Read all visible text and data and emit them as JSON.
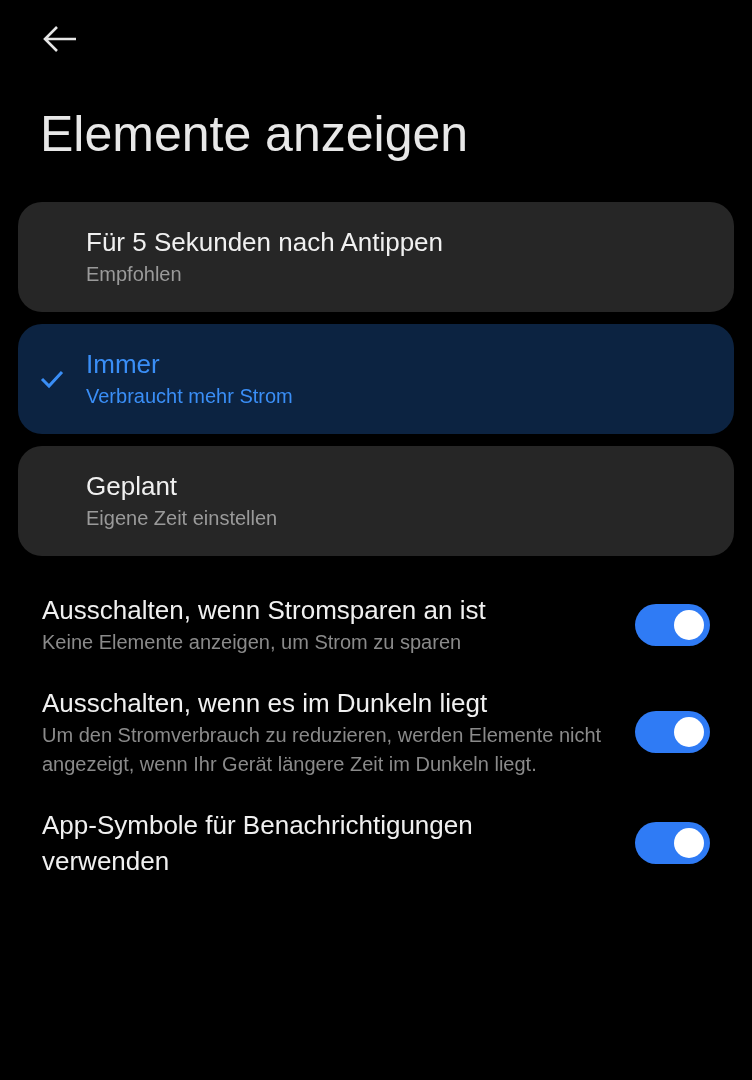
{
  "header": {
    "title": "Elemente anzeigen"
  },
  "options": [
    {
      "label": "Für 5 Sekunden nach Antippen",
      "description": "Empfohlen",
      "selected": false
    },
    {
      "label": "Immer",
      "description": "Verbraucht mehr Strom",
      "selected": true
    },
    {
      "label": "Geplant",
      "description": "Eigene Zeit einstellen",
      "selected": false
    }
  ],
  "settings": [
    {
      "label": "Ausschalten, wenn Stromsparen an ist",
      "description": "Keine Elemente anzeigen, um Strom zu sparen",
      "on": true
    },
    {
      "label": "Ausschalten, wenn es im Dunkeln liegt",
      "description": "Um den Stromverbrauch zu reduzieren, werden Elemente nicht angezeigt, wenn Ihr Gerät längere Zeit im Dunkeln liegt.",
      "on": true
    },
    {
      "label": "App-Symbole für Benachrichtigungen verwenden",
      "on": true
    }
  ]
}
